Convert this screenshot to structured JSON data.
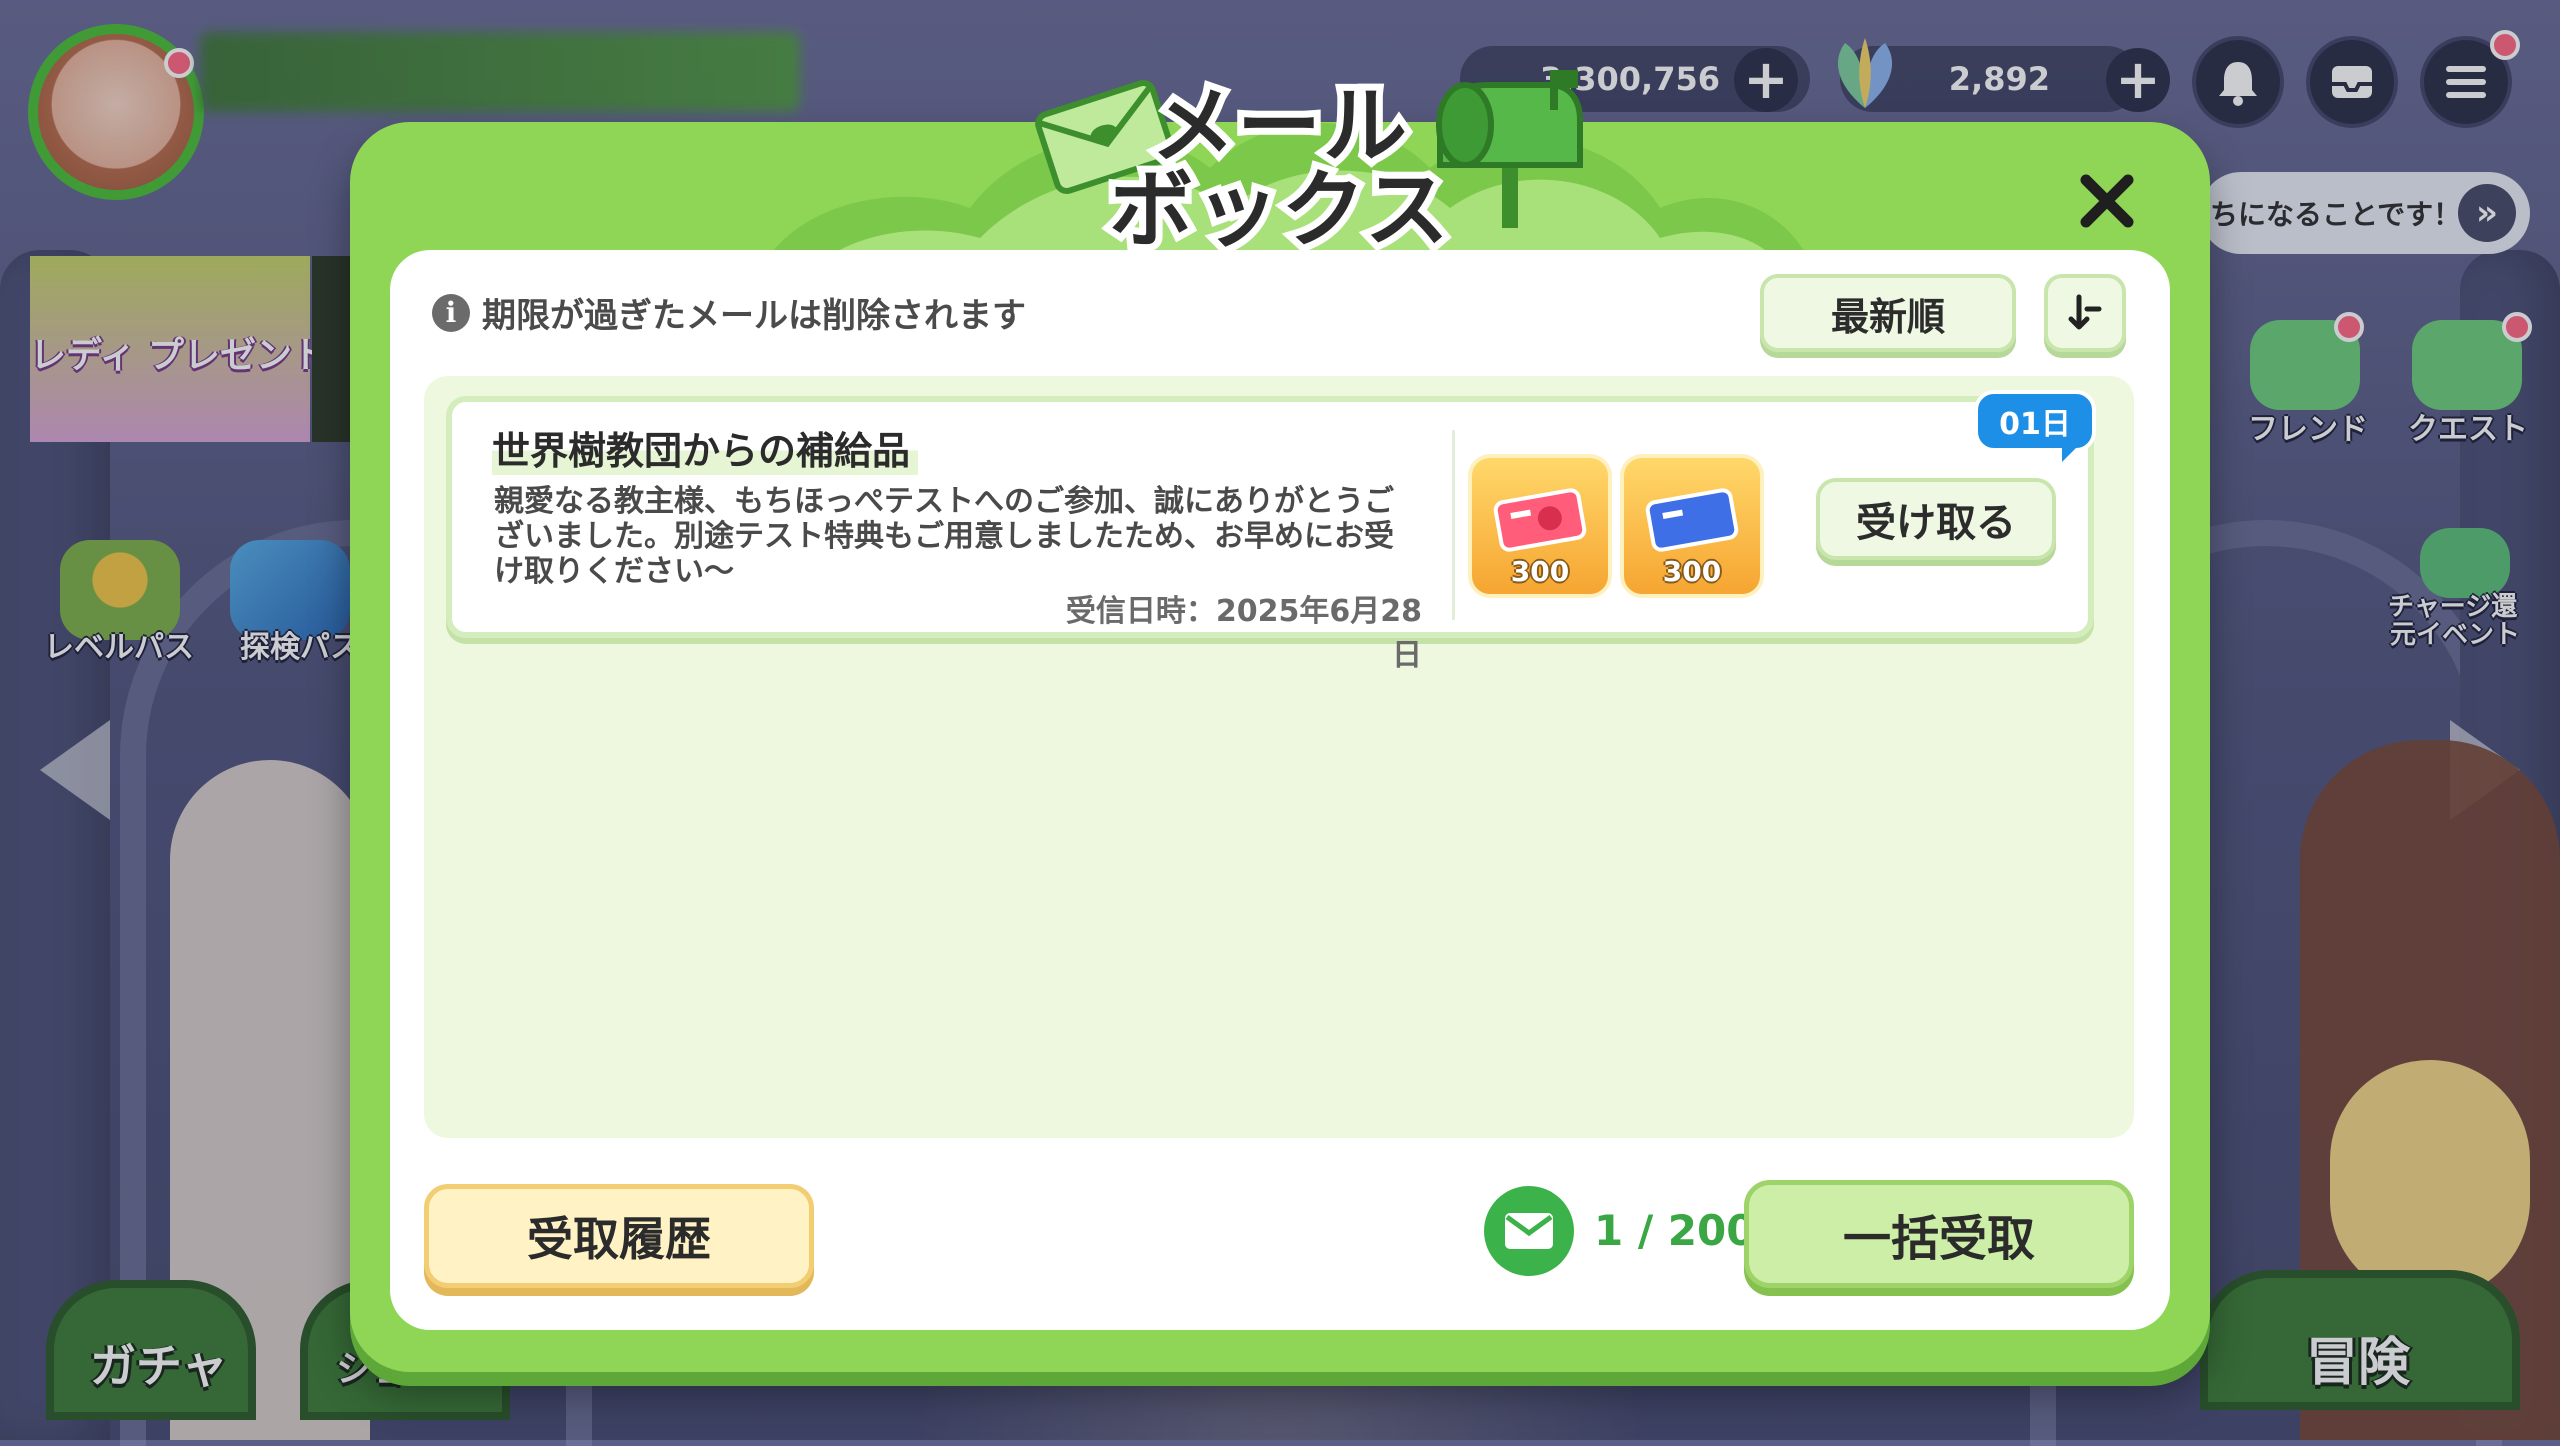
{
  "colors": {
    "modal_green": "#8fd657",
    "badge_blue": "#1e8fe6",
    "count_green": "#3ba644",
    "history_yellow": "#fff3c6"
  },
  "hud": {
    "coins": "3,300,756",
    "gems": "2,892",
    "plus_symbol": "+"
  },
  "side": {
    "lady_present": "レディ プレゼント",
    "level_pass": "レベルパス",
    "explore_pass": "探検パス",
    "friend": "フレンド",
    "quest": "クエスト",
    "charge_event_line1": "チャージ還",
    "charge_event_line2": "元イベント",
    "ticker": "ちになることです！"
  },
  "bottom": {
    "gacha": "ガチャ",
    "adventure": "冒険",
    "shop_partial": "ショ"
  },
  "mailbox": {
    "title_line1": "メール",
    "title_line2": "ボックス",
    "notice": "期限が過ぎたメールは削除されます",
    "sort_label": "最新順",
    "mails": [
      {
        "title": "世界樹教団からの補給品",
        "body": "親愛なる教主様、もちほっぺテストへのご参加、誠にありがとうございました。別途テスト特典もご用意しましたため、お早めにお受け取りください～",
        "date": "受信日時：2025年6月28日",
        "days_left": "01日",
        "receive_label": "受け取る",
        "rewards": [
          {
            "icon": "red-ticket-icon",
            "count": "300"
          },
          {
            "icon": "blue-ticket-icon",
            "count": "300"
          }
        ]
      }
    ],
    "history_label": "受取履歴",
    "mail_count": "1 / 200",
    "claim_all_label": "一括受取"
  }
}
